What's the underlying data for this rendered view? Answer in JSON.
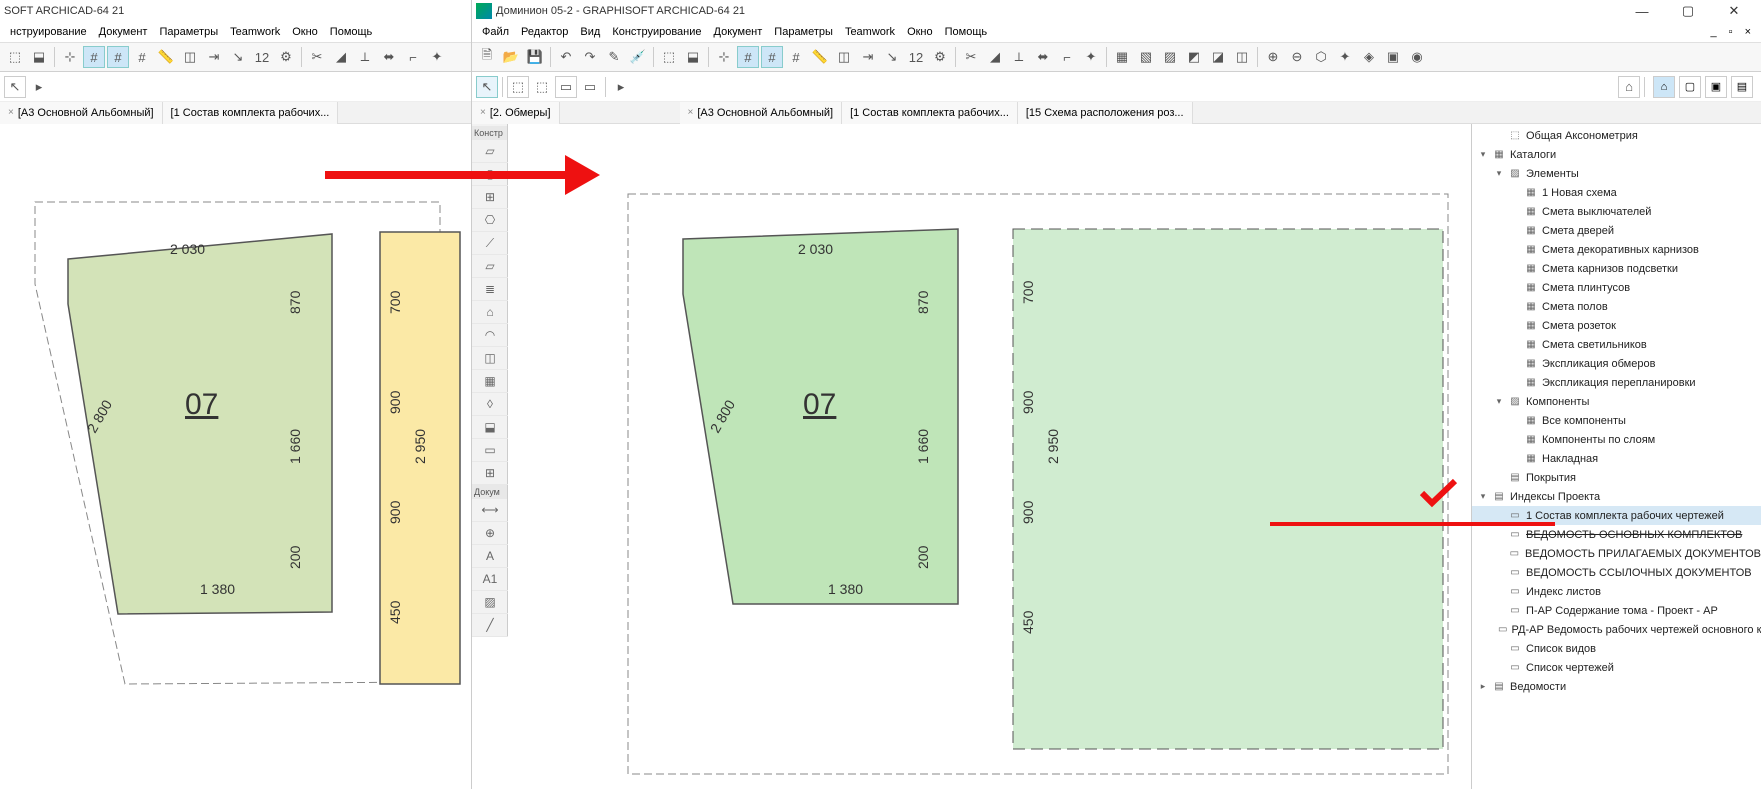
{
  "left_window": {
    "title": "SOFT ARCHICAD-64 21",
    "menus": [
      "нструирование",
      "Документ",
      "Параметры",
      "Teamwork",
      "Окно",
      "Помощь"
    ],
    "tabs": [
      {
        "label": "[А3 Основной Альбомный]"
      },
      {
        "label": "[1 Состав комплекта рабочих..."
      }
    ],
    "toolbox": {
      "section1": "Констр",
      "section2": "Докум"
    },
    "plan": {
      "room": "07",
      "dims": {
        "top": "2 030",
        "left_a": "870",
        "left_b": "1 660",
        "left_c": "200",
        "bottom": "1 380",
        "far_left": "2 800",
        "right_a": "700",
        "right_b": "900",
        "right_c": "2 950",
        "right_d": "450",
        "right_e": "900"
      }
    }
  },
  "right_window": {
    "title": "Доминион 05-2 - GRAPHISOFT ARCHICAD-64 21",
    "menus": [
      "Файл",
      "Редактор",
      "Вид",
      "Конструирование",
      "Документ",
      "Параметры",
      "Teamwork",
      "Окно",
      "Помощь"
    ],
    "tabs": [
      {
        "label": "[А3 Основной Альбомный]"
      },
      {
        "label": "[1 Состав комплекта рабочих..."
      },
      {
        "label": "[15 Схема расположения роз..."
      }
    ],
    "extra_tab": "[2. Обмеры]",
    "plan": {
      "room": "07",
      "dims": {
        "top": "2 030",
        "left_a": "870",
        "left_b": "1 660",
        "left_c": "200",
        "bottom": "1 380",
        "far_left": "2 800",
        "right_a": "700",
        "right_b": "900",
        "right_c": "2 950",
        "right_d": "450",
        "right_e": "900"
      }
    },
    "navigator": {
      "items": [
        {
          "indent": 1,
          "tw": "",
          "icon": "⬚",
          "label": "Общая Аксонометрия"
        },
        {
          "indent": 0,
          "tw": "▾",
          "icon": "▦",
          "label": "Каталоги"
        },
        {
          "indent": 1,
          "tw": "▾",
          "icon": "▨",
          "label": "Элементы"
        },
        {
          "indent": 2,
          "tw": "",
          "icon": "▦",
          "label": "1 Новая схема"
        },
        {
          "indent": 2,
          "tw": "",
          "icon": "▦",
          "label": "Смета выключателей"
        },
        {
          "indent": 2,
          "tw": "",
          "icon": "▦",
          "label": "Смета дверей"
        },
        {
          "indent": 2,
          "tw": "",
          "icon": "▦",
          "label": "Смета декоративных карнизов"
        },
        {
          "indent": 2,
          "tw": "",
          "icon": "▦",
          "label": "Смета карнизов подсветки"
        },
        {
          "indent": 2,
          "tw": "",
          "icon": "▦",
          "label": "Смета плинтусов"
        },
        {
          "indent": 2,
          "tw": "",
          "icon": "▦",
          "label": "Смета полов"
        },
        {
          "indent": 2,
          "tw": "",
          "icon": "▦",
          "label": "Смета розеток"
        },
        {
          "indent": 2,
          "tw": "",
          "icon": "▦",
          "label": "Смета светильников"
        },
        {
          "indent": 2,
          "tw": "",
          "icon": "▦",
          "label": "Экспликация обмеров"
        },
        {
          "indent": 2,
          "tw": "",
          "icon": "▦",
          "label": "Экспликация перепланировки"
        },
        {
          "indent": 1,
          "tw": "▾",
          "icon": "▨",
          "label": "Компоненты"
        },
        {
          "indent": 2,
          "tw": "",
          "icon": "▦",
          "label": "Все компоненты"
        },
        {
          "indent": 2,
          "tw": "",
          "icon": "▦",
          "label": "Компоненты по слоям"
        },
        {
          "indent": 2,
          "tw": "",
          "icon": "▦",
          "label": "Накладная"
        },
        {
          "indent": 1,
          "tw": "",
          "icon": "▤",
          "label": "Покрытия"
        },
        {
          "indent": 0,
          "tw": "▾",
          "icon": "▤",
          "label": "Индексы Проекта"
        },
        {
          "indent": 1,
          "tw": "",
          "icon": "▭",
          "label": "1 Состав комплекта рабочих чертежей",
          "sel": true
        },
        {
          "indent": 1,
          "tw": "",
          "icon": "▭",
          "label": "ВЕДОМОСТЬ ОСНОВНЫХ КОМПЛЕКТОВ",
          "strike": true
        },
        {
          "indent": 1,
          "tw": "",
          "icon": "▭",
          "label": "ВЕДОМОСТЬ ПРИЛАГАЕМЫХ ДОКУМЕНТОВ"
        },
        {
          "indent": 1,
          "tw": "",
          "icon": "▭",
          "label": "ВЕДОМОСТЬ ССЫЛОЧНЫХ ДОКУМЕНТОВ"
        },
        {
          "indent": 1,
          "tw": "",
          "icon": "▭",
          "label": "Индекс листов"
        },
        {
          "indent": 1,
          "tw": "",
          "icon": "▭",
          "label": "П-АР Содержание тома - Проект - АР"
        },
        {
          "indent": 1,
          "tw": "",
          "icon": "▭",
          "label": "РД-АР Ведомость рабочих чертежей основного к"
        },
        {
          "indent": 1,
          "tw": "",
          "icon": "▭",
          "label": "Список видов"
        },
        {
          "indent": 1,
          "tw": "",
          "icon": "▭",
          "label": "Список чертежей"
        },
        {
          "indent": 0,
          "tw": "▸",
          "icon": "▤",
          "label": "Ведомости"
        }
      ]
    }
  }
}
